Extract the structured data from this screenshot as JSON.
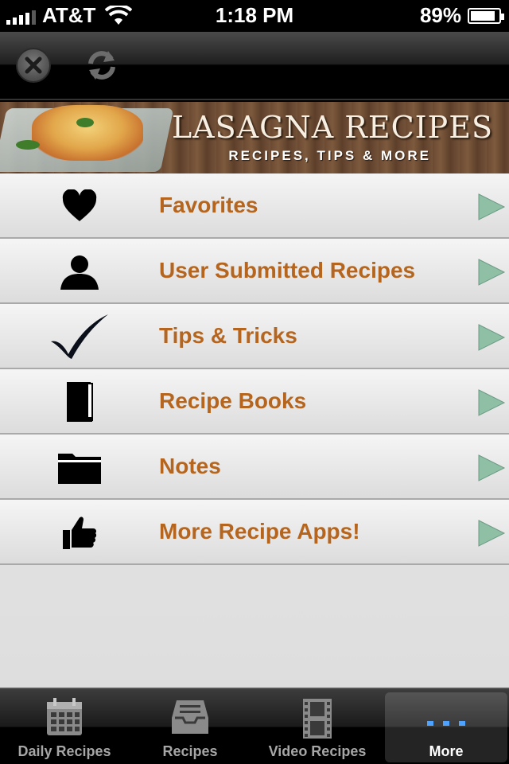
{
  "status_bar": {
    "carrier": "AT&T",
    "time": "1:18 PM",
    "battery": "89%",
    "battery_level": 0.89
  },
  "toolbar": {
    "close_icon": "close-icon",
    "refresh_icon": "refresh-icon"
  },
  "banner": {
    "title": "LASAGNA RECIPES",
    "subtitle": "RECIPES, TIPS & MORE"
  },
  "menu": {
    "items": [
      {
        "label": "Favorites",
        "icon": "heart-icon"
      },
      {
        "label": "User Submitted Recipes",
        "icon": "user-icon"
      },
      {
        "label": "Tips & Tricks",
        "icon": "checkmark-icon"
      },
      {
        "label": "Recipe Books",
        "icon": "book-icon"
      },
      {
        "label": "Notes",
        "icon": "folder-icon"
      },
      {
        "label": "More Recipe Apps!",
        "icon": "thumbs-up-icon"
      }
    ],
    "text_color": "#b5651d",
    "arrow_color": "#8fc0a6"
  },
  "tabbar": {
    "tabs": [
      {
        "label": "Daily Recipes",
        "icon": "calendar-icon"
      },
      {
        "label": "Recipes",
        "icon": "inbox-tray-icon"
      },
      {
        "label": "Video Recipes",
        "icon": "film-strip-icon"
      },
      {
        "label": "More",
        "icon": "more-dots-icon",
        "active": true
      }
    ]
  }
}
